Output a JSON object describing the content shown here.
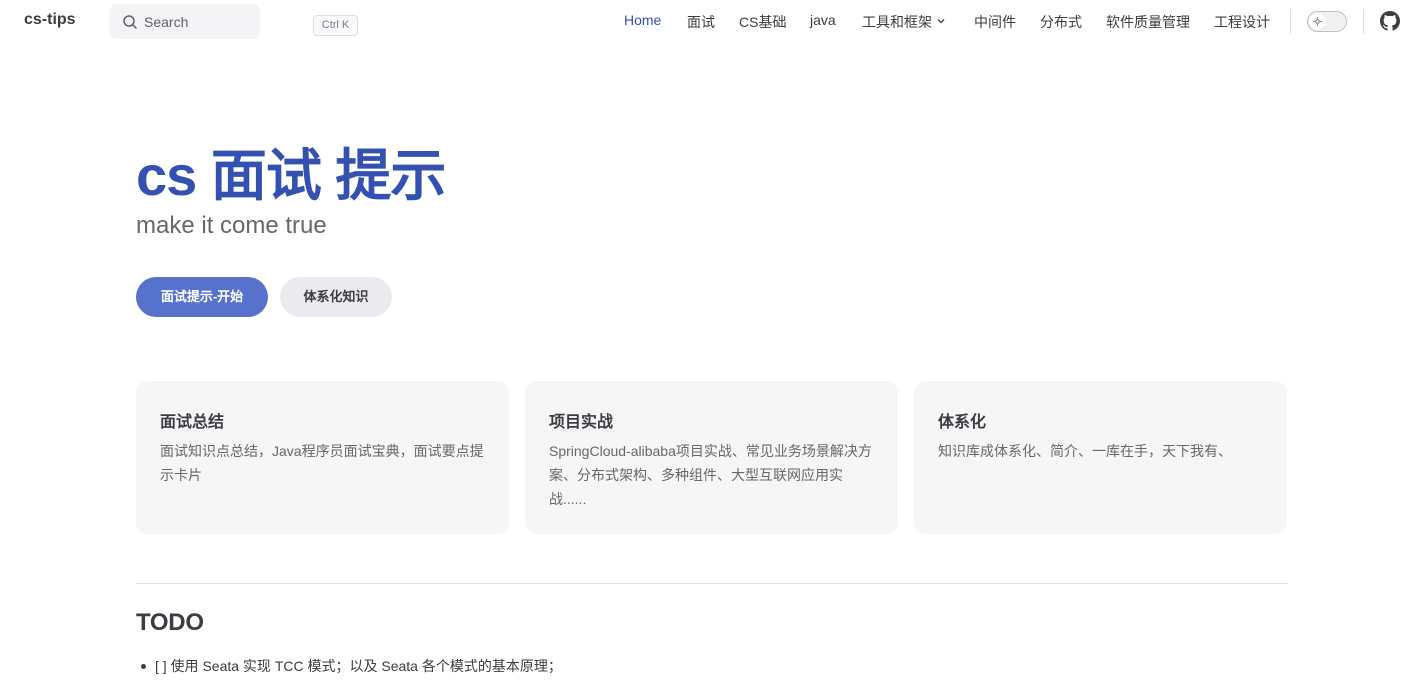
{
  "nav": {
    "brand": "cs-tips",
    "search": {
      "label": "Search",
      "shortcut": "Ctrl K"
    },
    "links": [
      {
        "label": "Home",
        "active": true
      },
      {
        "label": "面试"
      },
      {
        "label": "CS基础"
      },
      {
        "label": "java"
      },
      {
        "label": "工具和框架",
        "has_dropdown": true
      },
      {
        "label": "中间件"
      },
      {
        "label": "分布式"
      },
      {
        "label": "软件质量管理"
      },
      {
        "label": "工程设计"
      }
    ],
    "icons": {
      "search": "search-icon",
      "dropdown": "chevron-down-icon",
      "theme": "sun-icon",
      "github": "github-icon"
    }
  },
  "hero": {
    "title": "cs 面试 提示",
    "tagline": "make it come true",
    "actions": [
      {
        "label": "面试提示-开始",
        "style": "brand"
      },
      {
        "label": "体系化知识",
        "style": "alt"
      }
    ]
  },
  "features": [
    {
      "title": "面试总结",
      "details": "面试知识点总结，Java程序员面试宝典，面试要点提示卡片"
    },
    {
      "title": "项目实战",
      "details": "SpringCloud-alibaba项目实战、常见业务场景解决方案、分布式架构、多种组件、大型互联网应用实战......"
    },
    {
      "title": "体系化",
      "details": "知识库成体系化、简介、一库在手，天下我有、"
    }
  ],
  "todo": {
    "heading": "TODO",
    "items": [
      "[ ] 使用 Seata 实现 TCC 模式；以及 Seata 各个模式的基本原理；"
    ]
  },
  "colors": {
    "brand": "#3451b2",
    "brand_button": "#5672cd",
    "text": "#3c3c43",
    "muted": "#67676c",
    "card_bg": "#f6f6f7",
    "divider": "#e2e2e3"
  }
}
